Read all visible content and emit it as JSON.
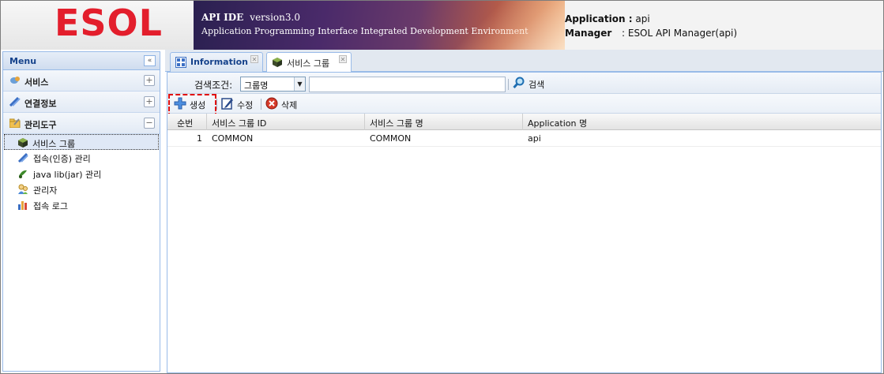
{
  "header": {
    "logo_text": "ESOL",
    "title": "API IDE",
    "version": "version3.0",
    "subtitle": "Application Programming Interface Integrated Development Environment",
    "application_label": "Application :",
    "application_value": "api",
    "manager_label": "Manager",
    "manager_value": ": ESOL API Manager(api)",
    "colors": {
      "logo": "#e31e2c",
      "banner": "#4a2a6a"
    }
  },
  "menu": {
    "title": "Menu",
    "collapse_glyph": "«",
    "groups": [
      {
        "label": "서비스",
        "toggle": "+",
        "icon": "service-icon"
      },
      {
        "label": "연결정보",
        "toggle": "+",
        "icon": "connection-icon"
      },
      {
        "label": "관리도구",
        "toggle": "−",
        "icon": "folder-icon"
      }
    ],
    "items": [
      {
        "label": "서비스 그룹",
        "icon": "cube-icon",
        "selected": true
      },
      {
        "label": "접속(인증) 관리",
        "icon": "link-icon"
      },
      {
        "label": "java lib(jar) 관리",
        "icon": "jar-icon"
      },
      {
        "label": "관리자",
        "icon": "users-icon"
      },
      {
        "label": "접속 로그",
        "icon": "bar-chart-icon"
      }
    ]
  },
  "tabs": [
    {
      "label": "Information",
      "icon": "grid-icon",
      "active": false
    },
    {
      "label": "서비스 그룹",
      "icon": "cube-icon",
      "active": true
    }
  ],
  "search": {
    "label": "검색조건:",
    "select_value": "그룹명",
    "input_value": "",
    "button_label": "검색"
  },
  "toolbar": {
    "create_label": "생성",
    "edit_label": "수정",
    "delete_label": "삭제"
  },
  "grid": {
    "columns": [
      "순번",
      "서비스 그룹 ID",
      "서비스 그룹 명",
      "Application 명"
    ],
    "rows": [
      [
        "1",
        "COMMON",
        "COMMON",
        "api"
      ]
    ]
  }
}
